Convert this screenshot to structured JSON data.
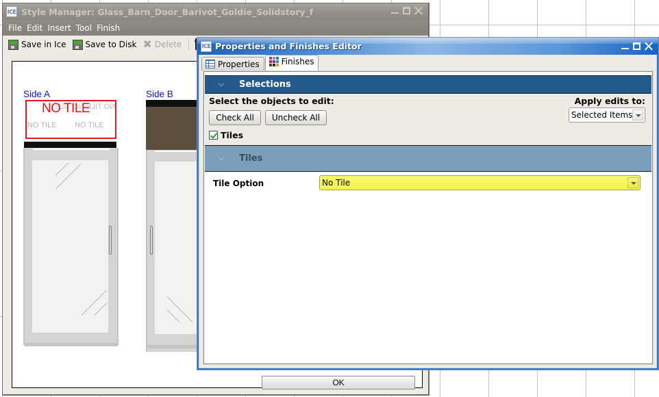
{
  "style_manager": {
    "title": "Style Manager: Glass_Barn_Door_Barivot_Goldie_Solidstory_f",
    "menu": [
      "File",
      "Edit",
      "Insert",
      "Tool",
      "Finish"
    ],
    "toolbar": {
      "save_in_ice": "Save in Ice",
      "save_to_disk": "Save to Disk",
      "delete": "Delete"
    },
    "preview": {
      "side_a_label": "Side A",
      "side_b_label": "Side B",
      "no_tile_main": "NO TILE",
      "no_tile_mirrored": "NO TILE NO TILE",
      "no_tile_small_left": "NO TILE",
      "no_tile_small_right": "NO TILE",
      "side_b_finish_color": "#5c4f3d"
    },
    "ok_label": "OK"
  },
  "editor": {
    "title": "Properties and Finishes Editor",
    "tabs": [
      {
        "label": "Properties",
        "active": false
      },
      {
        "label": "Finishes",
        "active": true
      }
    ],
    "selections": {
      "header": "Selections",
      "prompt": "Select the objects to edit:",
      "check_all": "Check All",
      "uncheck_all": "Uncheck All",
      "apply_label": "Apply edits to:",
      "apply_value": "Selected Items",
      "items": [
        {
          "label": "Tiles",
          "checked": true
        }
      ]
    },
    "tiles": {
      "header": "Tiles",
      "option_label": "Tile Option",
      "option_value": "No Tile",
      "highlight_color": "#f5f550"
    }
  }
}
